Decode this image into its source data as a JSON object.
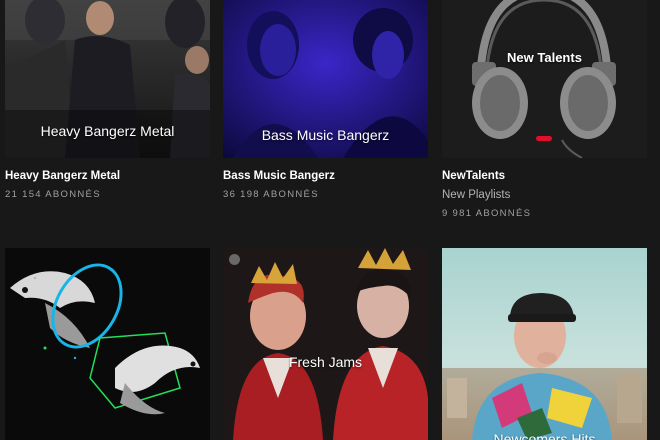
{
  "playlists": [
    {
      "cover_label": "Heavy Bangerz Metal",
      "title": "Heavy Bangerz Metal",
      "subtitle": "",
      "followers": "21 154 ABONNÉS"
    },
    {
      "cover_label": "Bass Music Bangerz",
      "title": "Bass Music Bangerz",
      "subtitle": "",
      "followers": "36 198 ABONNÉS"
    },
    {
      "cover_label": "New Talents",
      "title": "NewTalents",
      "subtitle": "New Playlists",
      "followers": "9 981 ABONNÉS"
    },
    {
      "cover_label": "",
      "title": "",
      "subtitle": "",
      "followers": ""
    },
    {
      "cover_label": "Fresh Jams",
      "title": "",
      "subtitle": "",
      "followers": ""
    },
    {
      "cover_label": "Newcomers Hits",
      "title": "",
      "subtitle": "",
      "followers": ""
    }
  ],
  "colors": {
    "background": "#181818",
    "title": "#ffffff",
    "secondary": "#b3b3b3"
  }
}
